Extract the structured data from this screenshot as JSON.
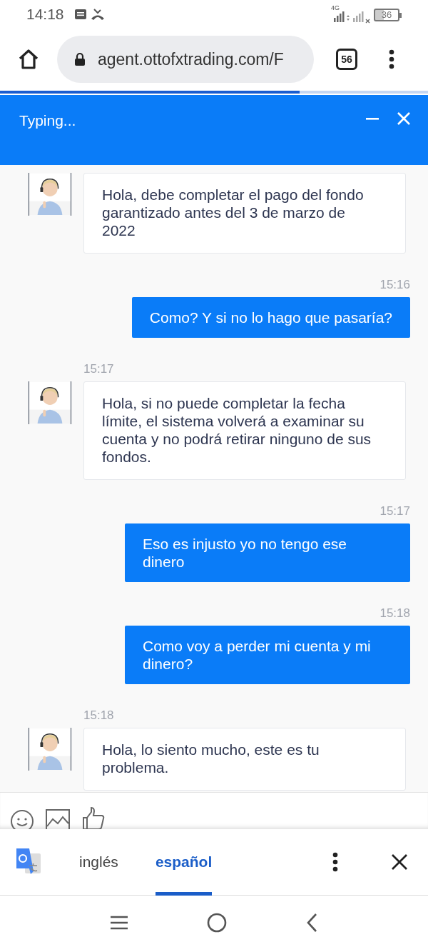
{
  "status_bar": {
    "time": "14:18",
    "network": "4G",
    "battery": "36"
  },
  "browser": {
    "url": "agent.ottofxtrading.com/F",
    "tab_count": "56",
    "load_progress": {
      "level": 0.7
    }
  },
  "chat": {
    "title": "Typing...",
    "messages": [
      {
        "kind": "agent",
        "text": "Hola, debe completar el pago del fondo garantizado antes del 3 de marzo de 2022"
      },
      {
        "kind": "user",
        "time": "15:16",
        "text": "Como? Y si no lo hago que pasaría?"
      },
      {
        "kind": "agent",
        "time": "15:17",
        "text": "Hola, si no puede completar la fecha límite, el sistema volverá a examinar su cuenta y no podrá retirar ninguno de sus fondos."
      },
      {
        "kind": "user",
        "time": "15:17",
        "text": "Eso es injusto yo no tengo ese dinero"
      },
      {
        "kind": "user",
        "time": "15:18",
        "text": "Como voy a perder mi cuenta y mi dinero?"
      },
      {
        "kind": "agent",
        "time": "15:18",
        "text": "Hola, lo siento mucho, este es tu problema."
      }
    ]
  },
  "translate_bar": {
    "languages": [
      {
        "label": "inglés",
        "selected": false
      },
      {
        "label": "español",
        "selected": true
      }
    ]
  }
}
